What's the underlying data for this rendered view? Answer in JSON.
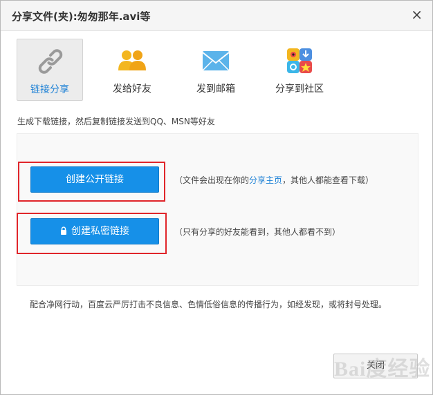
{
  "dialog": {
    "title": "分享文件(夹):匆匆那年.avi等",
    "close_glyph": "×"
  },
  "tabs": [
    {
      "label": "链接分享",
      "icon": "link-icon",
      "active": true
    },
    {
      "label": "发给好友",
      "icon": "friends-icon",
      "active": false
    },
    {
      "label": "发到邮箱",
      "icon": "mail-icon",
      "active": false
    },
    {
      "label": "分享到社区",
      "icon": "community-icon",
      "active": false
    }
  ],
  "description": "生成下载链接，然后复制链接发送到QQ、MSN等好友",
  "public_link": {
    "button_label": "创建公开链接",
    "hint_prefix": "（文件会出现在你的",
    "hint_link": "分享主页",
    "hint_suffix": "，其他人都能查看下载）"
  },
  "private_link": {
    "button_label": "创建私密链接",
    "hint": "（只有分享的好友能看到，其他人都看不到）"
  },
  "notice": "配合净网行动，百度云严厉打击不良信息、色情低俗信息的传播行为，如经发现，或将封号处理。",
  "footer": {
    "close_label": "关闭"
  },
  "watermark": "Bai度经验",
  "colors": {
    "primary_button": "#1690e8",
    "active_tab_text": "#1a7fd5",
    "highlight_frame": "#e0252a"
  }
}
